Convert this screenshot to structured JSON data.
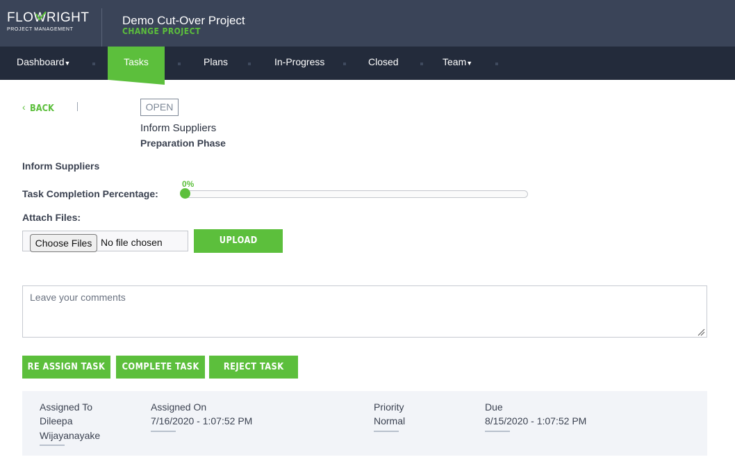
{
  "brand": {
    "logo_line1_a": "FLO",
    "logo_line1_b": "WRIGHT",
    "logo_line2": "PROJECT MANAGEMENT",
    "project_title": "Demo Cut-Over Project",
    "project_subtitle": "CHANGE PROJECT",
    "accent_color": "#5cbf3c",
    "header_color": "#3a4458",
    "nav_color": "#232b3b"
  },
  "nav": {
    "items": [
      {
        "label": "Dashboard",
        "dropdown": true
      },
      {
        "label": "Tasks",
        "dropdown": true,
        "active": true
      },
      {
        "label": "Plans"
      },
      {
        "label": "In-Progress"
      },
      {
        "label": "Closed"
      },
      {
        "label": "Team",
        "dropdown": true
      }
    ],
    "caret": "▾"
  },
  "task": {
    "back_label": "BACK",
    "status": "OPEN",
    "title": "Inform Suppliers",
    "phase": "Preparation Phase",
    "name_label": "Inform Suppliers",
    "completion_label": "Task Completion Percentage:",
    "completion_value": "0%",
    "completion_fraction": 0,
    "attach_label": "Attach Files:",
    "choose_files": "Choose Files",
    "no_file": "No file chosen",
    "upload": "UPLOAD",
    "comments_placeholder": "Leave your comments"
  },
  "actions": {
    "reassign": "RE ASSIGN TASK",
    "complete": "COMPLETE TASK",
    "reject": "REJECT TASK"
  },
  "info": {
    "assigned_to_label": "Assigned To",
    "assigned_to_line1": "Dileepa",
    "assigned_to_line2": "Wijayanayake",
    "assigned_on_label": "Assigned On",
    "assigned_on_value": "7/16/2020 - 1:07:52 PM",
    "priority_label": "Priority",
    "priority_value": "Normal",
    "due_label": "Due",
    "due_value": "8/15/2020 - 1:07:52 PM"
  }
}
